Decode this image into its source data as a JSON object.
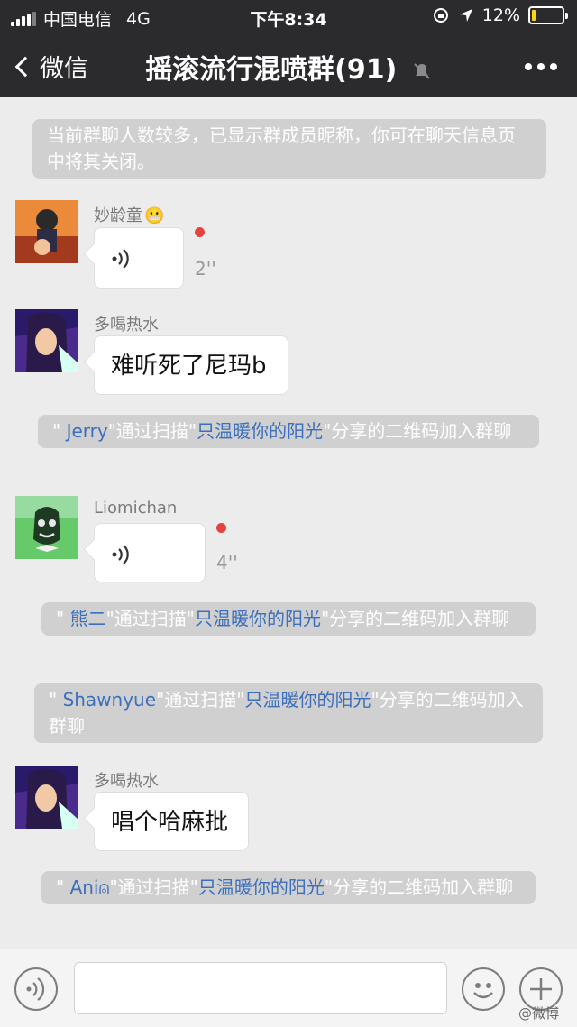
{
  "status_bar": {
    "carrier": "中国电信",
    "network": "4G",
    "time": "下午8:34",
    "battery_percent": "12%",
    "battery_level": 0.12
  },
  "nav": {
    "back_label": "微信",
    "title": "摇滚流行混喷群(91)",
    "more_icon": "more-icon",
    "mute_icon": "bell-mute-icon"
  },
  "messages": {
    "notice": "当前群聊人数较多，已显示群成员昵称，你可在聊天信息页中将其关闭。",
    "msg1": {
      "sender": "妙龄童",
      "emoji": "😬",
      "duration": "2''"
    },
    "msg2": {
      "sender": "多喝热水",
      "text": "难听死了尼玛b"
    },
    "join1": {
      "open": "\" ",
      "name": "Jerry",
      "mid": "\"通过扫描\"",
      "group": "只温暖你的阳光",
      "end": "\"分享的二维码加入群聊"
    },
    "msg3": {
      "sender": "Liomichan",
      "duration": "4''"
    },
    "join2": {
      "open": "\" ",
      "name": "熊二",
      "mid": "\"通过扫描\"",
      "group": "只温暖你的阳光",
      "end": "\"分享的二维码加入群聊"
    },
    "join3": {
      "open": "\" ",
      "name": "Shawnyue",
      "mid": "\"通过扫描\"",
      "group": "只温暖你的阳光",
      "end": "\"分享的二维码加入群聊"
    },
    "msg4": {
      "sender": "多喝热水",
      "text": "唱个哈麻批"
    },
    "join4": {
      "open": "\" ",
      "name": "Ani⍝",
      "mid": "\"通过扫描\"",
      "group": "只温暖你的阳光",
      "end": "\"分享的二维码加入群聊"
    }
  },
  "input_bar": {
    "voice_icon": "voice-toggle-icon",
    "emoji_icon": "emoji-icon",
    "plus_icon": "plus-icon",
    "watermark": "@微博"
  },
  "colors": {
    "bar_bg": "#2b2b2d",
    "chat_bg": "#ececec",
    "system_bg": "#d0d0d0",
    "link": "#3c6fbd",
    "unread": "#e64340",
    "battery": "#ffd21a"
  }
}
